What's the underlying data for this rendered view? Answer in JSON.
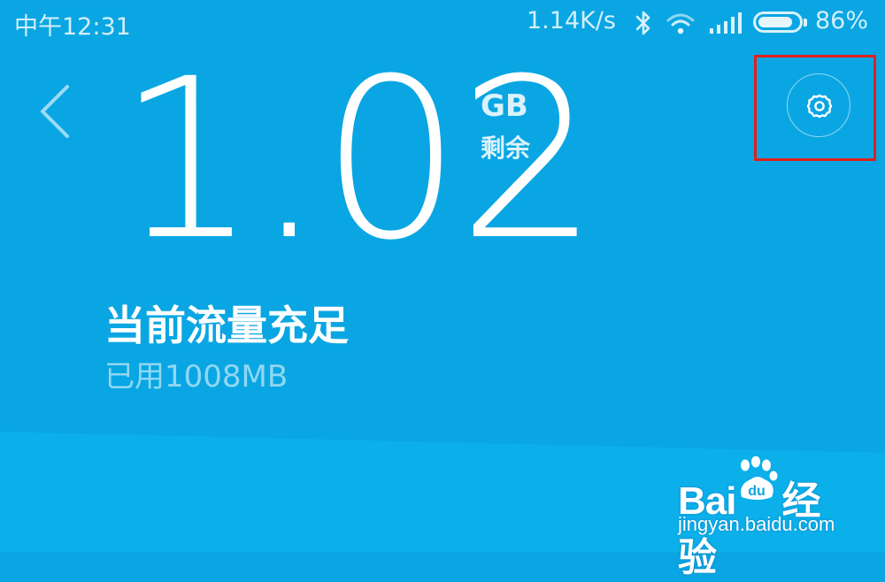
{
  "status_bar": {
    "time": "中午12:31",
    "net_speed": "1.14K/s",
    "battery_percent": "86%",
    "battery_level": 0.86,
    "icons": [
      "bluetooth-icon",
      "wifi-icon",
      "signal-icon",
      "battery-icon"
    ]
  },
  "header": {
    "back_icon": "chevron-left-icon",
    "remaining_value": "1.02",
    "remaining_unit": "GB",
    "remaining_label": "剩余",
    "settings_icon": "gear-icon"
  },
  "summary": {
    "status_title": "当前流量充足",
    "used_text": "已用1008MB"
  },
  "watermark": {
    "logo_text": "Bai du 经验",
    "url": "jingyan.baidu.com"
  },
  "colors": {
    "background": "#0aa6e3",
    "highlight_border": "#e0201c"
  }
}
